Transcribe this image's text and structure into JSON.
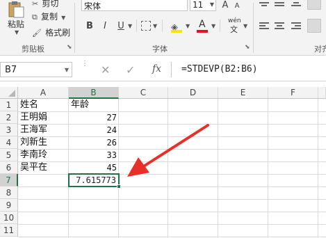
{
  "ribbon": {
    "clipboard": {
      "paste_label": "粘贴",
      "cut_label": "剪切",
      "copy_label": "复制",
      "format_painter_label": "格式刷",
      "group_label": "剪贴板"
    },
    "font": {
      "font_name": "宋体",
      "font_size": "11",
      "group_label": "字体",
      "bold_label": "B",
      "italic_label": "I",
      "underline_label": "U",
      "phonetic_label": "wén"
    },
    "alignment": {
      "group_label": "对齐"
    }
  },
  "formula_bar": {
    "name_box": "B7",
    "fx_label": "fx",
    "formula": "=STDEVP(B2:B6)"
  },
  "sheet": {
    "columns": [
      "A",
      "B",
      "C",
      "D",
      "E",
      "F"
    ],
    "rows": [
      "1",
      "2",
      "3",
      "4",
      "5",
      "6",
      "7",
      "8",
      "9",
      "10",
      "11"
    ],
    "cells": {
      "A1": "姓名",
      "B1": "年龄",
      "A2": "王明娟",
      "B2": "27",
      "A3": "王海军",
      "B3": "24",
      "A4": "刘新生",
      "B4": "26",
      "A5": "李南玲",
      "B5": "33",
      "A6": "吴平在",
      "B6": "45",
      "B7": "7.615773"
    },
    "selected_cell": "B7"
  },
  "colors": {
    "accent": "#217346",
    "arrow": "#e8302a",
    "font_color_underline": "#e81123",
    "highlight_color": "#ffe400"
  }
}
